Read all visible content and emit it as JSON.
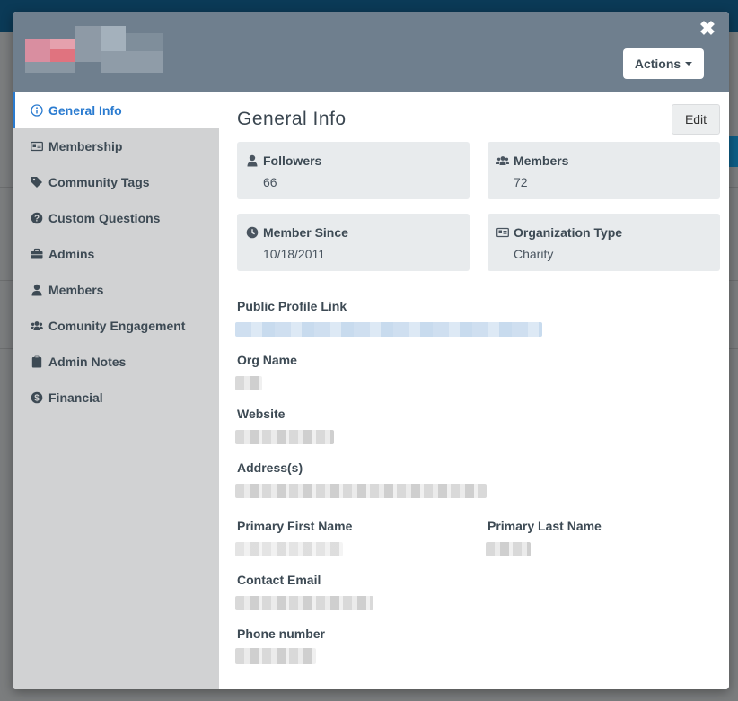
{
  "header": {
    "actions_label": "Actions"
  },
  "sidebar": {
    "items": [
      {
        "label": "General Info",
        "icon": "info-circle-icon"
      },
      {
        "label": "Membership",
        "icon": "id-card-icon"
      },
      {
        "label": "Community Tags",
        "icon": "tag-icon"
      },
      {
        "label": "Custom Questions",
        "icon": "question-circle-icon"
      },
      {
        "label": "Admins",
        "icon": "briefcase-icon"
      },
      {
        "label": "Members",
        "icon": "user-icon"
      },
      {
        "label": "Comunity Engagement",
        "icon": "users-icon"
      },
      {
        "label": "Admin Notes",
        "icon": "clipboard-icon"
      },
      {
        "label": "Financial",
        "icon": "dollar-circle-icon"
      }
    ]
  },
  "main": {
    "title": "General Info",
    "edit_label": "Edit",
    "stats": [
      {
        "label": "Followers",
        "value": "66",
        "icon": "user-icon"
      },
      {
        "label": "Members",
        "value": "72",
        "icon": "users-icon"
      },
      {
        "label": "Member Since",
        "value": "10/18/2011",
        "icon": "clock-icon"
      },
      {
        "label": "Organization Type",
        "value": "Charity",
        "icon": "id-card-icon"
      }
    ],
    "fields": {
      "public_profile_link": "Public Profile Link",
      "org_name": "Org Name",
      "website": "Website",
      "addresses": "Address(s)",
      "primary_first_name": "Primary First Name",
      "primary_last_name": "Primary Last Name",
      "contact_email": "Contact Email",
      "phone_number": "Phone number"
    }
  },
  "colors": {
    "header_bg": "#6f7f8e",
    "active_accent": "#2a7bd0",
    "sidebar_bg": "#d1d2d3",
    "card_bg": "#e8ebed"
  }
}
